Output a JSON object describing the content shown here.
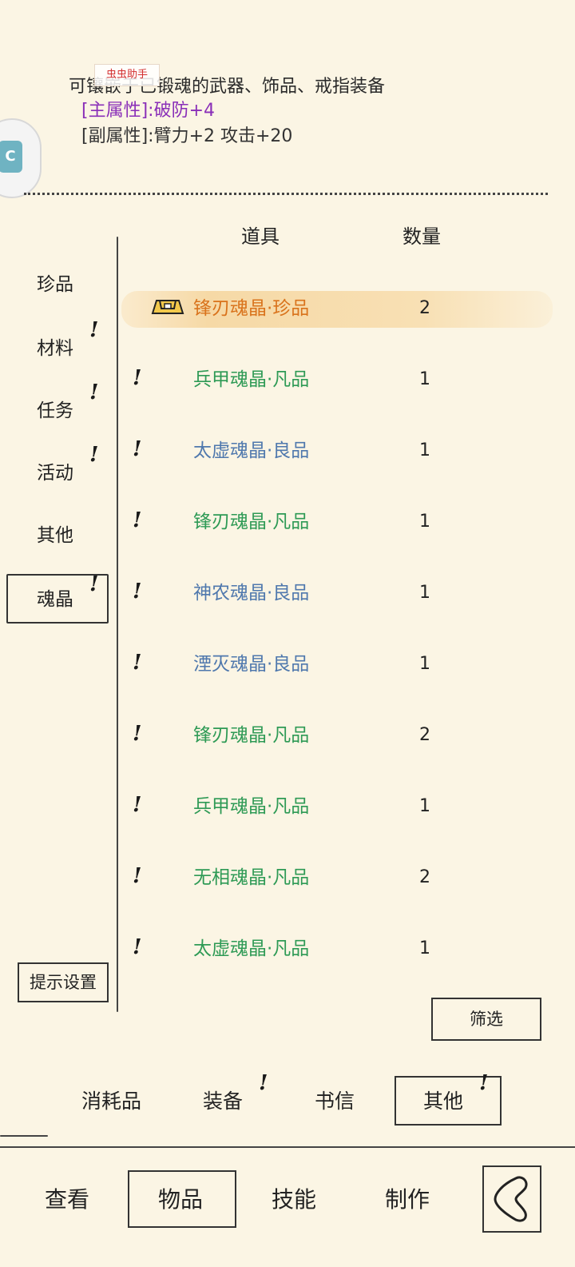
{
  "header": {
    "desc": "可镶嵌于已锻魂的武器、饰品、戒指装备",
    "main_attr": "[主属性]:破防+4",
    "sub_attr": "[副属性]:臂力+2 攻击+20",
    "watermark": "虫虫助手"
  },
  "columns": {
    "item": "道具",
    "qty": "数量"
  },
  "categories": [
    {
      "label": "珍品"
    },
    {
      "label": "材料"
    },
    {
      "label": "任务"
    },
    {
      "label": "活动"
    },
    {
      "label": "其他"
    },
    {
      "label": "魂晶"
    }
  ],
  "items": [
    {
      "name": "锋刃魂晶·珍品",
      "qty": "2",
      "quality": "rare"
    },
    {
      "name": "兵甲魂晶·凡品",
      "qty": "1",
      "quality": "common"
    },
    {
      "name": "太虚魂晶·良品",
      "qty": "1",
      "quality": "good"
    },
    {
      "name": "锋刃魂晶·凡品",
      "qty": "1",
      "quality": "common"
    },
    {
      "name": "神农魂晶·良品",
      "qty": "1",
      "quality": "good"
    },
    {
      "name": "湮灭魂晶·良品",
      "qty": "1",
      "quality": "good"
    },
    {
      "name": "锋刃魂晶·凡品",
      "qty": "2",
      "quality": "common"
    },
    {
      "name": "兵甲魂晶·凡品",
      "qty": "1",
      "quality": "common"
    },
    {
      "name": "无相魂晶·凡品",
      "qty": "2",
      "quality": "common"
    },
    {
      "name": "太虚魂晶·凡品",
      "qty": "1",
      "quality": "common"
    }
  ],
  "new_mark": "!",
  "buttons": {
    "tip_settings": "提示设置",
    "filter": "筛选"
  },
  "subtabs": [
    {
      "label": "消耗品"
    },
    {
      "label": "装备"
    },
    {
      "label": "书信"
    },
    {
      "label": "其他"
    }
  ],
  "maintabs": [
    {
      "label": "查看"
    },
    {
      "label": "物品"
    },
    {
      "label": "技能"
    },
    {
      "label": "制作"
    }
  ],
  "colors": {
    "rare": "#d9731c",
    "common": "#2e9a55",
    "good": "#4f78ad",
    "main_attr": "#8a2fb8"
  }
}
